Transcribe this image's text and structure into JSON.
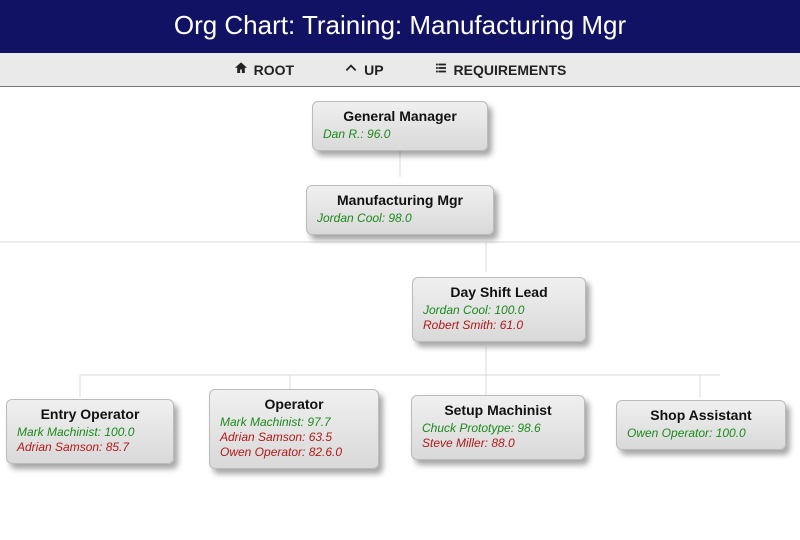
{
  "header": {
    "title": "Org Chart: Training: Manufacturing Mgr"
  },
  "toolbar": {
    "root": "ROOT",
    "up": "UP",
    "req": "REQUIREMENTS"
  },
  "nodes": {
    "gm": {
      "title": "General Manager",
      "people": [
        {
          "text": "Dan R.: 96.0",
          "c": "g"
        }
      ]
    },
    "mm": {
      "title": "Manufacturing Mgr",
      "people": [
        {
          "text": "Jordan Cool: 98.0",
          "c": "g"
        }
      ]
    },
    "dsl": {
      "title": "Day Shift Lead",
      "people": [
        {
          "text": "Jordan Cool: 100.0",
          "c": "g"
        },
        {
          "text": "Robert Smith: 61.0",
          "c": "r"
        }
      ]
    },
    "eo": {
      "title": "Entry Operator",
      "people": [
        {
          "text": "Mark Machinist: 100.0",
          "c": "g"
        },
        {
          "text": "Adrian Samson: 85.7",
          "c": "r"
        }
      ]
    },
    "op": {
      "title": "Operator",
      "people": [
        {
          "text": "Mark Machinist: 97.7",
          "c": "g"
        },
        {
          "text": "Adrian Samson: 63.5",
          "c": "r"
        },
        {
          "text": "Owen Operator: 82.6.0",
          "c": "r"
        }
      ]
    },
    "sm": {
      "title": "Setup Machinist",
      "people": [
        {
          "text": "Chuck Prototype: 98.6",
          "c": "g"
        },
        {
          "text": "Steve Miller: 88.0",
          "c": "r"
        }
      ]
    },
    "sa": {
      "title": "Shop Assistant",
      "people": [
        {
          "text": "Owen Operator: 100.0",
          "c": "g"
        }
      ]
    }
  }
}
